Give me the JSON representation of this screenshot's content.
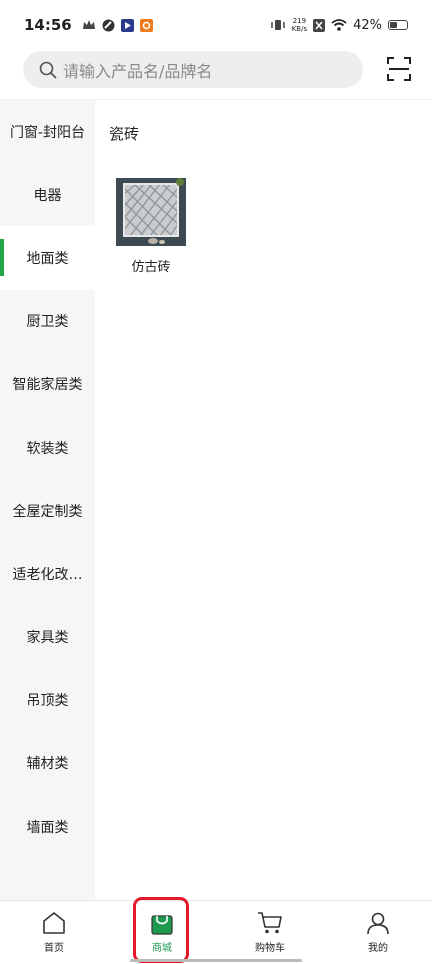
{
  "status": {
    "time": "14:56",
    "net_speed_value": "219",
    "net_speed_unit": "KB/s",
    "battery": "42%"
  },
  "search": {
    "placeholder": "请输入产品名/品牌名"
  },
  "sidebar": {
    "items": [
      {
        "label": "门窗-封阳台"
      },
      {
        "label": "电器"
      },
      {
        "label": "地面类"
      },
      {
        "label": "厨卫类"
      },
      {
        "label": "智能家居类"
      },
      {
        "label": "软装类"
      },
      {
        "label": "全屋定制类"
      },
      {
        "label": "适老化改…"
      },
      {
        "label": "家具类"
      },
      {
        "label": "吊顶类"
      },
      {
        "label": "辅材类"
      },
      {
        "label": "墙面类"
      }
    ],
    "active_index": 2
  },
  "content": {
    "section_title": "瓷砖",
    "products": [
      {
        "name": "仿古砖"
      }
    ]
  },
  "nav": {
    "items": [
      {
        "label": "首页",
        "icon": "home-icon"
      },
      {
        "label": "商城",
        "icon": "shop-bag-icon"
      },
      {
        "label": "购物车",
        "icon": "cart-icon"
      },
      {
        "label": "我的",
        "icon": "profile-icon"
      }
    ],
    "active_index": 1
  },
  "colors": {
    "accent": "#22a547",
    "highlight": "#e3182a"
  }
}
